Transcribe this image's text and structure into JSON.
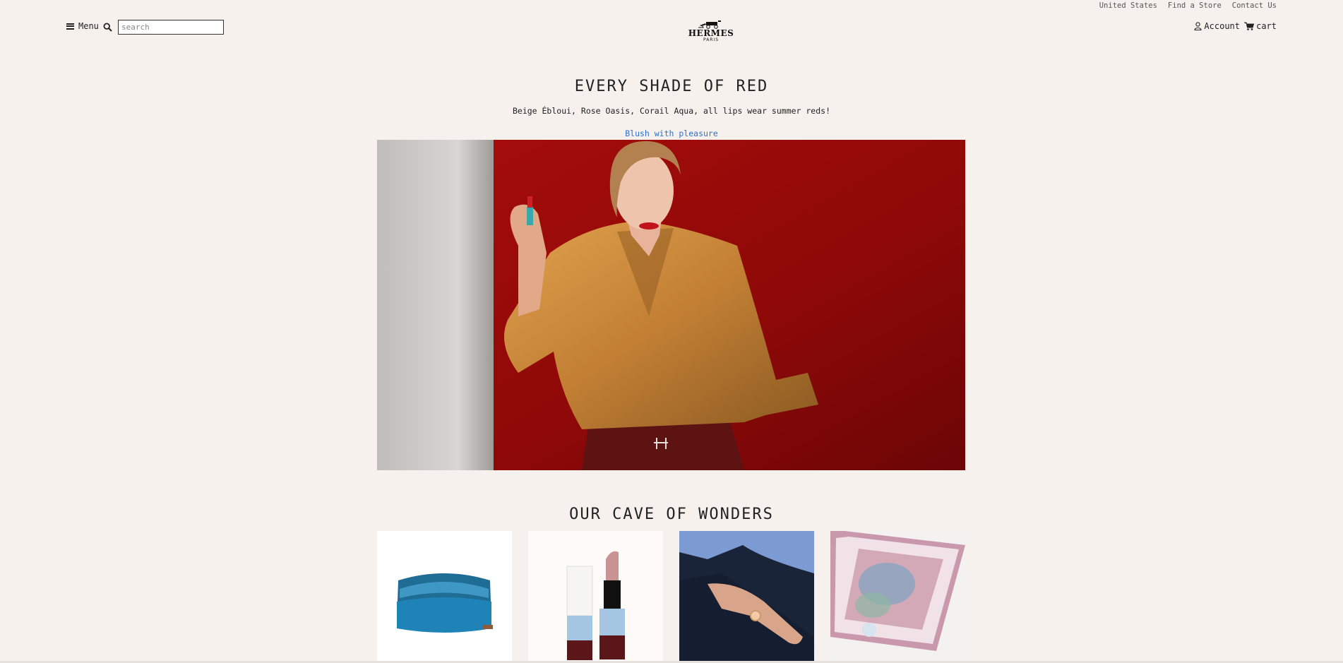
{
  "utility_links": [
    "United States",
    "Find a Store",
    "Contact Us"
  ],
  "header": {
    "menu_label": "Menu",
    "search_placeholder": "search",
    "logo_word": "HERMES",
    "logo_sub": "PARIS",
    "account_label": "Account",
    "cart_label": "cart"
  },
  "hero": {
    "title": "EVERY SHADE OF RED",
    "subtitle": "Beige Ébloui, Rose Oasis, Corail Aqua, all lips wear summer reds!",
    "link": "Blush with pleasure"
  },
  "section": {
    "title": "OUR CAVE OF WONDERS",
    "cards": [
      "blue-pouch",
      "lipsticks",
      "ring-hand",
      "silk-scarf"
    ]
  },
  "colors": {
    "background": "#f6f1ec",
    "link": "#2a6fd0",
    "hero_red": "#8c0a0a"
  }
}
